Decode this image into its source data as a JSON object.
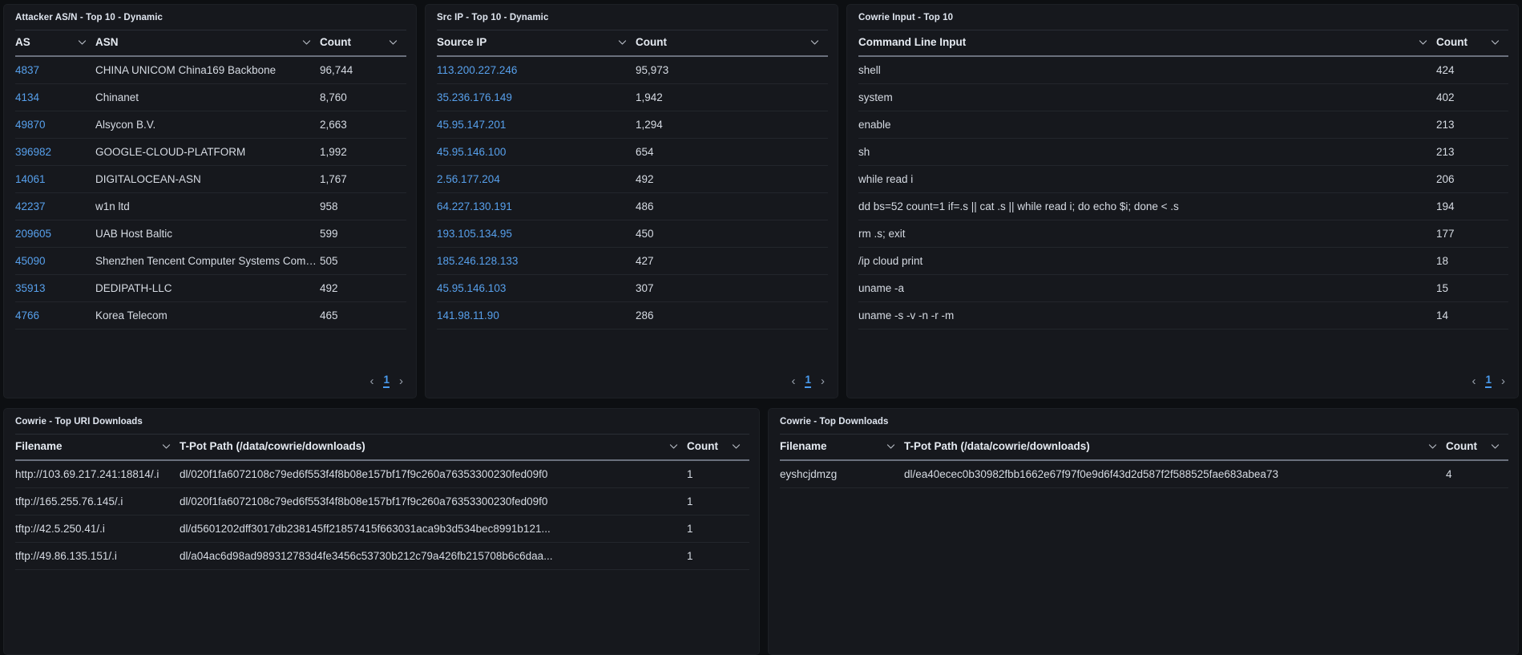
{
  "panels": {
    "attacker_asn": {
      "title": "Attacker AS/N - Top 10 - Dynamic",
      "columns": {
        "as": "AS",
        "asn": "ASN",
        "count": "Count"
      },
      "rows": [
        {
          "as": "4837",
          "asn": "CHINA UNICOM China169 Backbone",
          "count": "96,744"
        },
        {
          "as": "4134",
          "asn": "Chinanet",
          "count": "8,760"
        },
        {
          "as": "49870",
          "asn": "Alsycon B.V.",
          "count": "2,663"
        },
        {
          "as": "396982",
          "asn": "GOOGLE-CLOUD-PLATFORM",
          "count": "1,992"
        },
        {
          "as": "14061",
          "asn": "DIGITALOCEAN-ASN",
          "count": "1,767"
        },
        {
          "as": "42237",
          "asn": "w1n ltd",
          "count": "958"
        },
        {
          "as": "209605",
          "asn": "UAB Host Baltic",
          "count": "599"
        },
        {
          "as": "45090",
          "asn": "Shenzhen Tencent Computer Systems Company ...",
          "count": "505"
        },
        {
          "as": "35913",
          "asn": "DEDIPATH-LLC",
          "count": "492"
        },
        {
          "as": "4766",
          "asn": "Korea Telecom",
          "count": "465"
        }
      ],
      "pagination": {
        "prev": "‹",
        "page": "1",
        "next": "›"
      }
    },
    "src_ip": {
      "title": "Src IP - Top 10 - Dynamic",
      "columns": {
        "ip": "Source IP",
        "count": "Count"
      },
      "rows": [
        {
          "ip": "113.200.227.246",
          "count": "95,973"
        },
        {
          "ip": "35.236.176.149",
          "count": "1,942"
        },
        {
          "ip": "45.95.147.201",
          "count": "1,294"
        },
        {
          "ip": "45.95.146.100",
          "count": "654"
        },
        {
          "ip": "2.56.177.204",
          "count": "492"
        },
        {
          "ip": "64.227.130.191",
          "count": "486"
        },
        {
          "ip": "193.105.134.95",
          "count": "450"
        },
        {
          "ip": "185.246.128.133",
          "count": "427"
        },
        {
          "ip": "45.95.146.103",
          "count": "307"
        },
        {
          "ip": "141.98.11.90",
          "count": "286"
        }
      ],
      "pagination": {
        "prev": "‹",
        "page": "1",
        "next": "›"
      }
    },
    "cowrie_input": {
      "title": "Cowrie Input - Top 10",
      "columns": {
        "cmd": "Command Line Input",
        "count": "Count"
      },
      "rows": [
        {
          "cmd": "shell",
          "count": "424"
        },
        {
          "cmd": "system",
          "count": "402"
        },
        {
          "cmd": "enable",
          "count": "213"
        },
        {
          "cmd": "sh",
          "count": "213"
        },
        {
          "cmd": "while read i",
          "count": "206"
        },
        {
          "cmd": "dd bs=52 count=1 if=.s || cat .s || while read i; do echo $i; done < .s",
          "count": "194"
        },
        {
          "cmd": "rm .s; exit",
          "count": "177"
        },
        {
          "cmd": "/ip cloud print",
          "count": "18"
        },
        {
          "cmd": "uname -a",
          "count": "15"
        },
        {
          "cmd": "uname -s -v -n -r -m",
          "count": "14"
        }
      ],
      "pagination": {
        "prev": "‹",
        "page": "1",
        "next": "›"
      }
    },
    "top_uri_downloads": {
      "title": "Cowrie - Top URI Downloads",
      "columns": {
        "filename": "Filename",
        "path": "T-Pot Path (/data/cowrie/downloads)",
        "count": "Count"
      },
      "rows": [
        {
          "filename": "http://103.69.217.241:18814/.i",
          "path": "dl/020f1fa6072108c79ed6f553f4f8b08e157bf17f9c260a76353300230fed09f0",
          "count": "1"
        },
        {
          "filename": "tftp://165.255.76.145/.i",
          "path": "dl/020f1fa6072108c79ed6f553f4f8b08e157bf17f9c260a76353300230fed09f0",
          "count": "1"
        },
        {
          "filename": "tftp://42.5.250.41/.i",
          "path": "dl/d5601202dff3017db238145ff21857415f663031aca9b3d534bec8991b121...",
          "count": "1"
        },
        {
          "filename": "tftp://49.86.135.151/.i",
          "path": "dl/a04ac6d98ad989312783d4fe3456c53730b212c79a426fb215708b6c6daa...",
          "count": "1"
        }
      ]
    },
    "top_downloads": {
      "title": "Cowrie - Top Downloads",
      "columns": {
        "filename": "Filename",
        "path": "T-Pot Path (/data/cowrie/downloads)",
        "count": "Count"
      },
      "rows": [
        {
          "filename": "eyshcjdmzg",
          "path": "dl/ea40ecec0b30982fbb1662e67f97f0e9d6f43d2d587f2f588525fae683abea73",
          "count": "4"
        }
      ]
    }
  }
}
